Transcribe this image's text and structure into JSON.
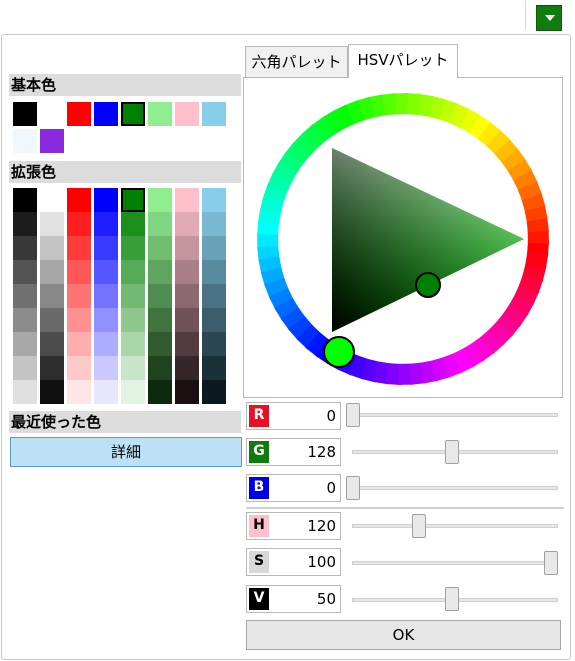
{
  "top_bar": {
    "dropdown_color": "#107c10",
    "dropdown_icon": "chevron-down-icon"
  },
  "left": {
    "basic_title": "基本色",
    "basic_colors": [
      "#000000",
      "#ffffff",
      "#ff0000",
      "#0000ff",
      "#008000",
      "#90ee90",
      "#ffc0cb",
      "#87ceeb",
      "#f0f8ff",
      "#8a2be2"
    ],
    "extended_title": "拡張色",
    "recent_title": "最近使った色",
    "detail_button": "詳細"
  },
  "tabs": {
    "hex_palette": "六角パレット",
    "hsv_palette": "HSVパレット",
    "active": "HSVパレット"
  },
  "channels": {
    "r": {
      "label": "R",
      "value": "0",
      "fraction": 0.0,
      "color": "#e81123"
    },
    "g": {
      "label": "G",
      "value": "128",
      "fraction": 0.502,
      "color": "#107c10"
    },
    "b": {
      "label": "B",
      "value": "0",
      "fraction": 0.0,
      "color": "#0000e6"
    },
    "h": {
      "label": "H",
      "value": "120",
      "fraction": 0.333,
      "color": "#ffc0cb"
    },
    "s": {
      "label": "S",
      "value": "100",
      "fraction": 1.0,
      "color": "#d8d8d8"
    },
    "v": {
      "label": "V",
      "value": "50",
      "fraction": 0.5,
      "color": "#000000"
    }
  },
  "ok_button": "OK"
}
